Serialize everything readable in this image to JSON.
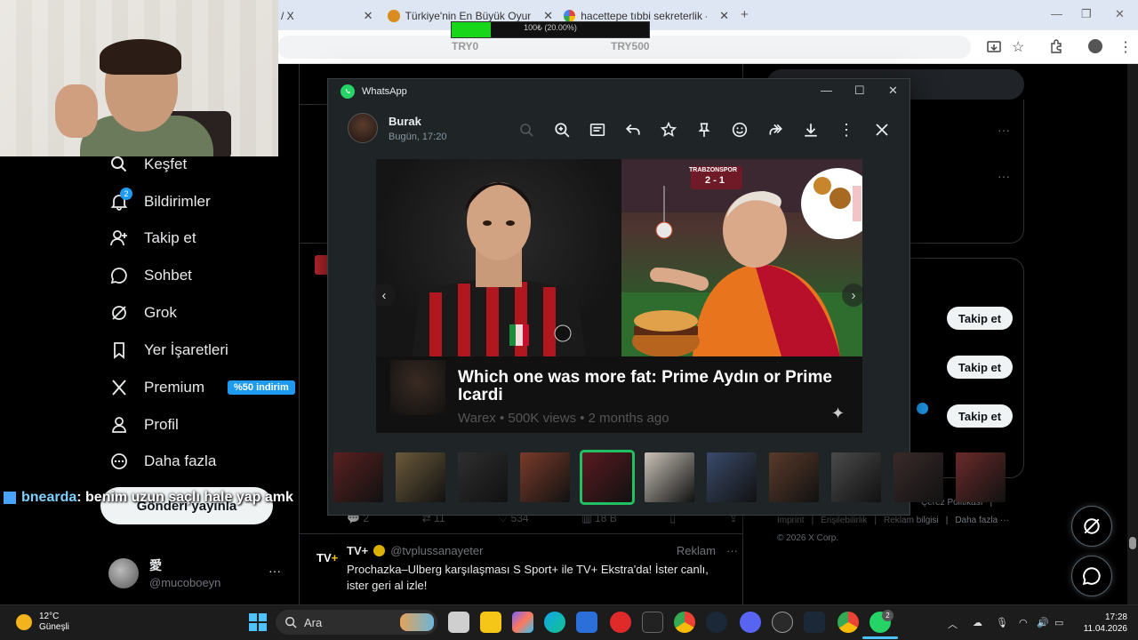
{
  "browser": {
    "tabs": [
      {
        "label": "/ X",
        "icon": "x-logo-icon"
      },
      {
        "label": "Türkiye'nin En Büyük Oyuncu D...",
        "icon": "site-favicon-icon"
      },
      {
        "label": "hacettepe tıbbi sekreterlik - Go...",
        "icon": "google-favicon-icon"
      }
    ],
    "new_tab": "+"
  },
  "donation_bar": {
    "progress_text": "100₺ (20.00%)",
    "progress_fraction": 0.2,
    "left_label": "TRY0",
    "right_label": "TRY500"
  },
  "sidebar": {
    "items": [
      {
        "label": "Keşfet",
        "icon": "search-icon"
      },
      {
        "label": "Bildirimler",
        "icon": "bell-icon",
        "badge": "2"
      },
      {
        "label": "Takip et",
        "icon": "person-add-icon"
      },
      {
        "label": "Sohbet",
        "icon": "chat-bubble-icon"
      },
      {
        "label": "Grok",
        "icon": "grok-icon"
      },
      {
        "label": "Yer İşaretleri",
        "icon": "bookmark-icon"
      },
      {
        "label": "Premium",
        "icon": "x-logo-icon",
        "badge": "%50 indirim"
      },
      {
        "label": "Profil",
        "icon": "user-icon"
      },
      {
        "label": "Daha fazla",
        "icon": "more-circle-icon"
      }
    ],
    "post_button": "Gönderi yayınla",
    "profile": {
      "name": "愛",
      "handle": "@mucoboeyn",
      "more": "···"
    }
  },
  "stream_chat": {
    "user": "bnearda",
    "message": ": benim uzun saçlı hale yap amk"
  },
  "feed": {
    "tweet_actions": [
      {
        "icon": "reply-icon",
        "count": "2"
      },
      {
        "icon": "retweet-icon",
        "count": "11"
      },
      {
        "icon": "heart-icon",
        "count": "534"
      },
      {
        "icon": "views-icon",
        "count": "18 B"
      }
    ],
    "ad_tweet": {
      "name": "TV+",
      "handle": "@tvplussanayeter",
      "tag": "Reklam",
      "text": "Prochazka–Ulberg karşılaşması S Sport+ ile TV+ Ekstra'da! İster canlı, ister geri al izle!"
    }
  },
  "right_column": {
    "follow_label": "Takip et",
    "footer_links": [
      "Çerez Politikası",
      "|",
      "Imprint",
      "|",
      "Erişilebilirlik",
      "|",
      "Reklam bilgisi",
      "|",
      "Daha fazla ···"
    ],
    "copyright": "© 2026 X Corp."
  },
  "whatsapp": {
    "window_title": "WhatsApp",
    "sender_name": "Burak",
    "sent_time": "Bugün, 17:20",
    "toolbar": [
      "search-icon",
      "zoom-in-icon",
      "caption-icon",
      "reply-icon",
      "star-icon",
      "pin-icon",
      "emoji-icon",
      "forward-icon",
      "download-icon",
      "more-vertical-icon",
      "close-icon"
    ],
    "media": {
      "scoreboard": "2 - 1",
      "scoreboard_top": "TRABZONSPOR",
      "title": "Which one was more fat: Prime Aydın or Prime Icardi",
      "meta": "Warex • 500K views • 2 months ago"
    },
    "thumbnail_count": 11
  },
  "taskbar": {
    "weather_temp": "12°C",
    "weather_desc": "Güneşli",
    "search_placeholder": "Ara",
    "time": "17:28",
    "date": "11.04.2026"
  },
  "colors": {
    "x_blue": "#1d9bf0",
    "whatsapp_green": "#25d366",
    "donation_green": "#18d71b",
    "selected_thumb": "#21c063"
  }
}
